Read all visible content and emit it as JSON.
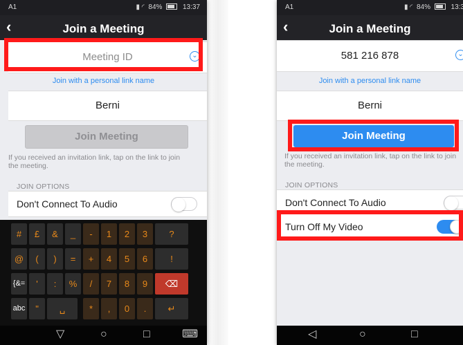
{
  "colors": {
    "accent": "#2d8cf0",
    "highlight": "#ff1a1a",
    "header": "#232327",
    "key_orange": "#e8891a"
  },
  "left_phone": {
    "status": {
      "carrier": "A1 ",
      "signal": "📶",
      "battery": "84%",
      "time": "13:37"
    },
    "title": "Join a Meeting",
    "back_icon": "‹",
    "meeting_id": {
      "placeholder": "Meeting ID",
      "value": ""
    },
    "personal_link": "Join with a personal link name",
    "name_value": "Berni",
    "join_button": "Join Meeting",
    "hint": "If you received an invitation link, tap on the link to join the meeting.",
    "join_options_header": "JOIN OPTIONS",
    "audio_option": {
      "label": "Don't Connect To Audio",
      "on": false
    },
    "keyboard": {
      "row1": [
        "#",
        "£",
        "&",
        "_",
        "-",
        "1",
        "2",
        "3",
        "?"
      ],
      "row2": [
        "@",
        "(",
        ")",
        "=",
        "+",
        "4",
        "5",
        "6",
        "!"
      ],
      "row3": [
        "{&=",
        "'",
        ":",
        "%",
        "/",
        "7",
        "8",
        "9",
        "⌫"
      ],
      "row4": [
        "abc",
        "\"",
        "␣",
        "*",
        ",",
        "0",
        ".",
        "↵"
      ]
    },
    "navbar": {
      "back": "▽",
      "home": "○",
      "recent": "□",
      "keyboard_icon": "⌨"
    }
  },
  "right_phone": {
    "status": {
      "carrier": "A1 ",
      "battery": "84%",
      "time": "13:3"
    },
    "title": "Join a Meeting",
    "back_icon": "‹",
    "meeting_id_value": "581 216 878",
    "personal_link": "Join with a personal link name",
    "name_value": "Berni",
    "join_button": "Join Meeting",
    "hint": "If you received an invitation link, tap on the link to join the meeting.",
    "join_options_header": "JOIN OPTIONS",
    "audio_option": {
      "label": "Don't Connect To Audio",
      "on": false
    },
    "video_option": {
      "label": "Turn Off My Video",
      "on": true
    },
    "navbar": {
      "back": "◁",
      "home": "○",
      "recent": "□"
    }
  }
}
